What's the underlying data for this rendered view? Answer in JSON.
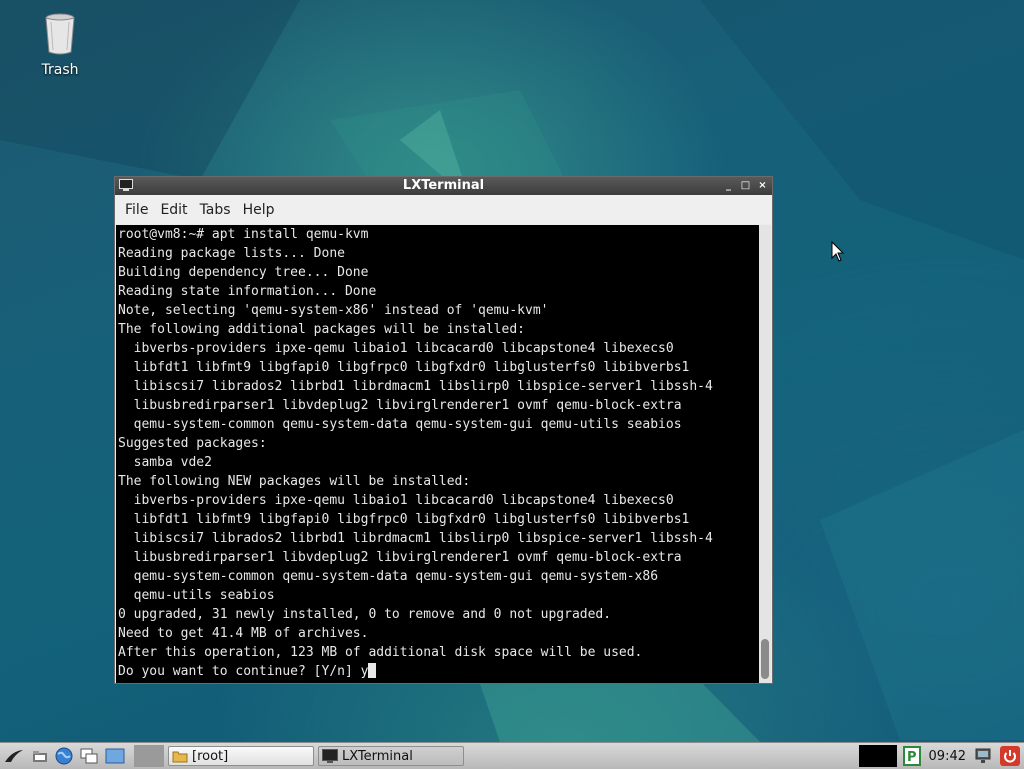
{
  "desktop": {
    "icons": [
      {
        "label": "Trash",
        "icon": "trash-icon"
      }
    ]
  },
  "window": {
    "title": "LXTerminal",
    "controls": {
      "minimize": "_",
      "maximize": "□",
      "close": "×"
    },
    "menu": [
      "File",
      "Edit",
      "Tabs",
      "Help"
    ],
    "terminal": {
      "lines": [
        "root@vm8:~# apt install qemu-kvm",
        "Reading package lists... Done",
        "Building dependency tree... Done",
        "Reading state information... Done",
        "Note, selecting 'qemu-system-x86' instead of 'qemu-kvm'",
        "The following additional packages will be installed:",
        "  ibverbs-providers ipxe-qemu libaio1 libcacard0 libcapstone4 libexecs0",
        "  libfdt1 libfmt9 libgfapi0 libgfrpc0 libgfxdr0 libglusterfs0 libibverbs1",
        "  libiscsi7 librados2 librbd1 librdmacm1 libslirp0 libspice-server1 libssh-4",
        "  libusbredirparser1 libvdeplug2 libvirglrenderer1 ovmf qemu-block-extra",
        "  qemu-system-common qemu-system-data qemu-system-gui qemu-utils seabios",
        "Suggested packages:",
        "  samba vde2",
        "The following NEW packages will be installed:",
        "  ibverbs-providers ipxe-qemu libaio1 libcacard0 libcapstone4 libexecs0",
        "  libfdt1 libfmt9 libgfapi0 libgfrpc0 libgfxdr0 libglusterfs0 libibverbs1",
        "  libiscsi7 librados2 librbd1 librdmacm1 libslirp0 libspice-server1 libssh-4",
        "  libusbredirparser1 libvdeplug2 libvirglrenderer1 ovmf qemu-block-extra",
        "  qemu-system-common qemu-system-data qemu-system-gui qemu-system-x86",
        "  qemu-utils seabios",
        "0 upgraded, 31 newly installed, 0 to remove and 0 not upgraded.",
        "Need to get 41.4 MB of archives.",
        "After this operation, 123 MB of additional disk space will be used."
      ],
      "prompt_line": "Do you want to continue? [Y/n] y"
    }
  },
  "taskbar": {
    "launchers": [
      "lxde-menu-icon",
      "file-manager-icon",
      "browser-icon",
      "windows-icon",
      "desktop-icon"
    ],
    "tasks": [
      {
        "label": "[root]",
        "icon": "folder-icon"
      },
      {
        "label": "LXTerminal",
        "icon": "terminal-icon"
      }
    ],
    "clock": "09:42"
  },
  "colors": {
    "terminal_bg": "#000000",
    "terminal_fg": "#e8e8e8",
    "accent": "#1a6a7a"
  }
}
